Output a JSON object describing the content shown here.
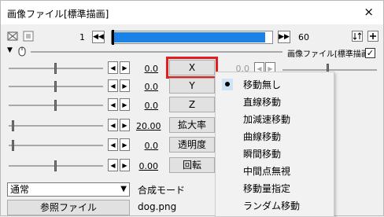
{
  "window": {
    "title": "画像ファイル[標準描画]",
    "close_glyph": "×"
  },
  "toolbar": {
    "frame_start": "1",
    "frame_end": "60",
    "timeline_progress": 0.96
  },
  "filter": {
    "label": "画像ファイル[標準描画]",
    "checked": "✓"
  },
  "params": [
    {
      "name": "X",
      "value": "0.0",
      "highlighted": true
    },
    {
      "name": "Y",
      "value": "0.0"
    },
    {
      "name": "Z",
      "value": "0.0"
    },
    {
      "name": "拡大率",
      "value": "20.00"
    },
    {
      "name": "透明度",
      "value": "0.0"
    },
    {
      "name": "回転",
      "value": "0.00"
    }
  ],
  "right_values": {
    "x_value": "0.0"
  },
  "blend": {
    "selected": "通常",
    "label": "合成モード"
  },
  "file": {
    "button_label": "参照ファイル",
    "name": "dog.png"
  },
  "menu": {
    "items": [
      "移動無し",
      "直線移動",
      "加減速移動",
      "曲線移動",
      "瞬間移動",
      "中間点無視",
      "移動量指定",
      "ランダム移動"
    ],
    "selected_index": 0
  },
  "colors": {
    "accent": "#1a82e6",
    "highlight": "#e02020"
  }
}
